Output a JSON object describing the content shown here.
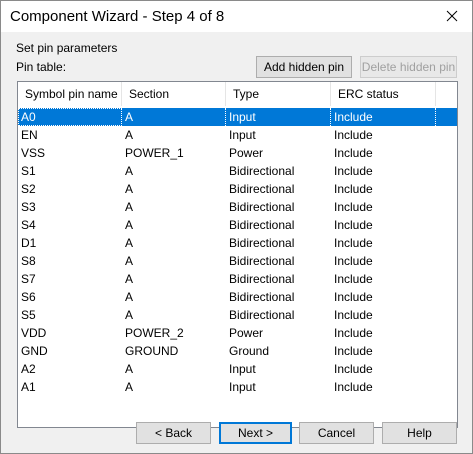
{
  "window": {
    "title": "Component Wizard - Step 4 of 8"
  },
  "header": {
    "section_label": "Set pin parameters",
    "pin_table_label": "Pin table:"
  },
  "toolbar": {
    "add_hidden_pin": "Add hidden pin",
    "delete_hidden_pin": "Delete hidden pin"
  },
  "table": {
    "columns": [
      "Symbol pin name",
      "Section",
      "Type",
      "ERC status"
    ],
    "rows": [
      [
        "A0",
        "A",
        "Input",
        "Include"
      ],
      [
        "EN",
        "A",
        "Input",
        "Include"
      ],
      [
        "VSS",
        "POWER_1",
        "Power",
        "Include"
      ],
      [
        "S1",
        "A",
        "Bidirectional",
        "Include"
      ],
      [
        "S2",
        "A",
        "Bidirectional",
        "Include"
      ],
      [
        "S3",
        "A",
        "Bidirectional",
        "Include"
      ],
      [
        "S4",
        "A",
        "Bidirectional",
        "Include"
      ],
      [
        "D1",
        "A",
        "Bidirectional",
        "Include"
      ],
      [
        "S8",
        "A",
        "Bidirectional",
        "Include"
      ],
      [
        "S7",
        "A",
        "Bidirectional",
        "Include"
      ],
      [
        "S6",
        "A",
        "Bidirectional",
        "Include"
      ],
      [
        "S5",
        "A",
        "Bidirectional",
        "Include"
      ],
      [
        "VDD",
        "POWER_2",
        "Power",
        "Include"
      ],
      [
        "GND",
        "GROUND",
        "Ground",
        "Include"
      ],
      [
        "A2",
        "A",
        "Input",
        "Include"
      ],
      [
        "A1",
        "A",
        "Input",
        "Include"
      ]
    ]
  },
  "footer": {
    "back": "< Back",
    "next": "Next >",
    "cancel": "Cancel",
    "help": "Help"
  },
  "icons": {
    "close": "close-icon"
  },
  "colors": {
    "selection": "#0078d7",
    "default_button_border": "#0078d7"
  }
}
